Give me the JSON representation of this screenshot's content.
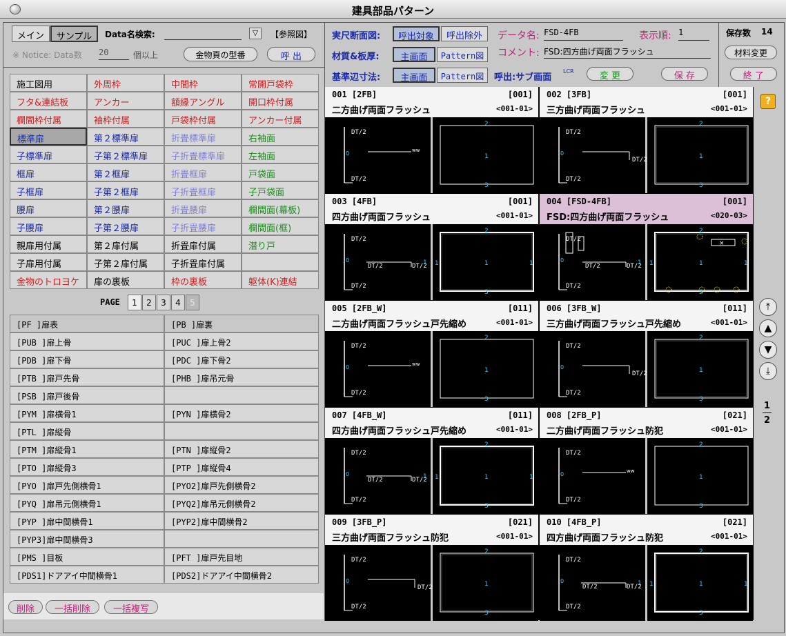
{
  "window": {
    "title": "建具部品パターン"
  },
  "top_left": {
    "tab_main": "メイン",
    "tab_sample": "サンプル",
    "search_label": "Data名検索:",
    "search_value": "",
    "dropdown_icon": "▽",
    "ref_button": "【参照図】",
    "notice": "※ Notice: Data数",
    "notice_value": "20",
    "notice_suffix": "個以上",
    "kanamono_button": "金物頁の型番",
    "call_button": "呼 出"
  },
  "top_mid": {
    "row1_label": "実尺断面図:",
    "row1_btn1": "呼出対象",
    "row1_btn2": "呼出除外",
    "row2_label": "材質&板厚:",
    "row2_btn1": "主画面",
    "row2_btn2": "Pattern図",
    "row3_label": "基準辺寸法:",
    "row3_btn1": "主画面",
    "row3_btn2": "Pattern図",
    "sub_label": "呼出:サブ画面",
    "lcr": "LCR",
    "dataname_label": "データ名:",
    "dataname_value": "FSD-4FB",
    "order_label": "表示順:",
    "order_value": "1",
    "comment_label": "コメント:",
    "comment_value": "FSD:四方曲げ両面フラッシュ",
    "change_button": "変 更",
    "save_button": "保 存"
  },
  "top_right": {
    "saved_label": "保存数",
    "saved_value": "14",
    "material_button": "材料変更",
    "exit_button": "終 了"
  },
  "categories": [
    {
      "label": "施工図用",
      "color": "#000"
    },
    {
      "label": "外周枠",
      "color": "#c82020"
    },
    {
      "label": "中間枠",
      "color": "#c82020"
    },
    {
      "label": "常開戸袋枠",
      "color": "#c82020"
    },
    {
      "label": "フタ&連結板",
      "color": "#c82020"
    },
    {
      "label": "アンカー",
      "color": "#c82020"
    },
    {
      "label": "額縁アングル",
      "color": "#c82020"
    },
    {
      "label": "開口枠付属",
      "color": "#c82020"
    },
    {
      "label": "欄間枠付属",
      "color": "#c82020"
    },
    {
      "label": "袖枠付属",
      "color": "#c82020"
    },
    {
      "label": "戸袋枠付属",
      "color": "#c82020"
    },
    {
      "label": "アンカー付属",
      "color": "#c82020"
    },
    {
      "label": "標準扉",
      "color": "#1a2aa8",
      "selected": true
    },
    {
      "label": "第２標準扉",
      "color": "#1a2aa8"
    },
    {
      "label": "折畳標準扉",
      "color": "#8080d8"
    },
    {
      "label": "右袖面",
      "color": "#208a20"
    },
    {
      "label": "子標準扉",
      "color": "#1a2aa8"
    },
    {
      "label": "子第２標準扉",
      "color": "#1a2aa8"
    },
    {
      "label": "子折畳標準扉",
      "color": "#8080d8"
    },
    {
      "label": "左袖面",
      "color": "#208a20"
    },
    {
      "label": "框扉",
      "color": "#1a2aa8"
    },
    {
      "label": "第２框扉",
      "color": "#1a2aa8"
    },
    {
      "label": "折畳框扉",
      "color": "#8080d8"
    },
    {
      "label": "戸袋面",
      "color": "#208a20"
    },
    {
      "label": "子框扉",
      "color": "#1a2aa8"
    },
    {
      "label": "子第２框扉",
      "color": "#1a2aa8"
    },
    {
      "label": "子折畳框扉",
      "color": "#8080d8"
    },
    {
      "label": "子戸袋面",
      "color": "#208a20"
    },
    {
      "label": "腰扉",
      "color": "#1a2aa8"
    },
    {
      "label": "第２腰扉",
      "color": "#1a2aa8"
    },
    {
      "label": "折畳腰扉",
      "color": "#8080d8"
    },
    {
      "label": "欄間面(幕板)",
      "color": "#208a20"
    },
    {
      "label": "子腰扉",
      "color": "#1a2aa8"
    },
    {
      "label": "子第２腰扉",
      "color": "#1a2aa8"
    },
    {
      "label": "子折畳腰扉",
      "color": "#8080d8"
    },
    {
      "label": "欄間面(框)",
      "color": "#208a20"
    },
    {
      "label": "親扉用付属",
      "color": "#000"
    },
    {
      "label": "第２扉付属",
      "color": "#000"
    },
    {
      "label": "折畳扉付属",
      "color": "#000"
    },
    {
      "label": "潜り戸",
      "color": "#208a20"
    },
    {
      "label": "子扉用付属",
      "color": "#000"
    },
    {
      "label": "子第２扉付属",
      "color": "#000"
    },
    {
      "label": "子折畳扉付属",
      "color": "#000"
    },
    {
      "label": "",
      "color": "#000"
    },
    {
      "label": "金物のトロヨケ",
      "color": "#c82020"
    },
    {
      "label": "扉の裏板",
      "color": "#000"
    },
    {
      "label": "枠の裏板",
      "color": "#c82020"
    },
    {
      "label": "躯体(K)連結",
      "color": "#c82020"
    }
  ],
  "pager": {
    "label": "PAGE",
    "pages": [
      "1",
      "2",
      "3",
      "4",
      "5"
    ],
    "current": "1"
  },
  "parts": [
    "[PF  ]扉表",
    "[PB  ]扉裏",
    "[PUB ]扉上骨",
    "[PUC ]扉上骨2",
    "[PDB ]扉下骨",
    "[PDC ]扉下骨2",
    "[PTB ]扉戸先骨",
    "[PHB ]扉吊元骨",
    "[PSB ]扉戸後骨",
    "",
    "[PYM ]扉横骨1",
    "[PYN ]扉横骨2",
    "[PTL ]扉縦骨",
    "",
    "[PTM ]扉縦骨1",
    "[PTN ]扉縦骨2",
    "[PTO ]扉縦骨3",
    "[PTP ]扉縦骨4",
    "[PYO ]扉戸先側横骨1",
    "[PYO2]扉戸先側横骨2",
    "[PYQ ]扉吊元側横骨1",
    "[PYQ2]扉吊元側横骨2",
    "[PYP ]扉中間横骨1",
    "[PYP2]扉中間横骨2",
    "[PYP3]扉中間横骨3",
    "",
    "[PMS ]目板",
    "[PFT ]扉戸先目地",
    "[PDS1]ドアアイ中間横骨1",
    "[PDS2]ドアアイ中間横骨2"
  ],
  "bottom_buttons": {
    "delete": "削除",
    "bulk_delete": "一括削除",
    "bulk_copy": "一括複写"
  },
  "cards": [
    {
      "id": "001",
      "code": "[2FB]",
      "tag": "[001]",
      "name": "二方曲げ両面フラッシュ",
      "sub": "<001-01>",
      "variant": "a",
      "selected": false
    },
    {
      "id": "002",
      "code": "[3FB]",
      "tag": "[001]",
      "name": "三方曲げ両面フラッシュ",
      "sub": "<001-01>",
      "variant": "b",
      "selected": false
    },
    {
      "id": "003",
      "code": "[4FB]",
      "tag": "[001]",
      "name": "四方曲げ両面フラッシュ",
      "sub": "<001-01>",
      "variant": "c",
      "selected": false
    },
    {
      "id": "004",
      "code": "[FSD-4FB]",
      "tag": "[001]",
      "name": "FSD:四方曲げ両面フラッシュ",
      "sub": "<020-03>",
      "variant": "d",
      "selected": true
    },
    {
      "id": "005",
      "code": "[2FB_W]",
      "tag": "[011]",
      "name": "二方曲げ両面フラッシュ戸先縮め",
      "sub": "<001-01>",
      "variant": "a",
      "selected": false
    },
    {
      "id": "006",
      "code": "[3FB_W]",
      "tag": "[011]",
      "name": "三方曲げ両面フラッシュ戸先縮め",
      "sub": "<001-01>",
      "variant": "b",
      "selected": false
    },
    {
      "id": "007",
      "code": "[4FB_W]",
      "tag": "[011]",
      "name": "四方曲げ両面フラッシュ戸先縮め",
      "sub": "<001-01>",
      "variant": "c",
      "selected": false
    },
    {
      "id": "008",
      "code": "[2FB_P]",
      "tag": "[021]",
      "name": "二方曲げ両面フラッシュ防犯",
      "sub": "<001-01>",
      "variant": "a",
      "selected": false
    },
    {
      "id": "009",
      "code": "[3FB_P]",
      "tag": "[021]",
      "name": "三方曲げ両面フラッシュ防犯",
      "sub": "<001-01>",
      "variant": "b",
      "selected": false
    },
    {
      "id": "010",
      "code": "[4FB_P]",
      "tag": "[021]",
      "name": "四方曲げ両面フラッシュ防犯",
      "sub": "<001-01>",
      "variant": "c",
      "selected": false
    }
  ],
  "drawing_labels": {
    "dt2": "DT/2",
    "n1": "1",
    "n2": "2",
    "n3": "3"
  },
  "right_strip": {
    "help_icon": "?",
    "page_top": "1",
    "page_bottom": "2"
  }
}
